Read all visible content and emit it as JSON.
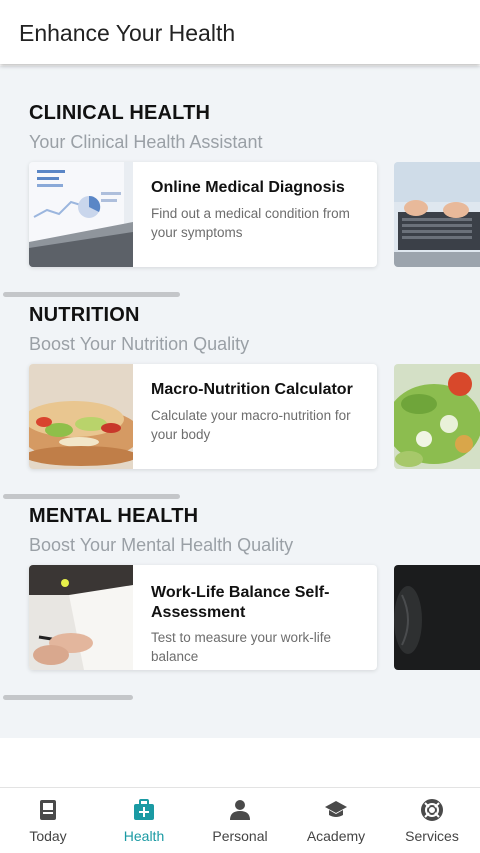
{
  "app_bar": {
    "title": "Enhance Your Health"
  },
  "sections": [
    {
      "title": "CLINICAL HEALTH",
      "subtitle": "Your Clinical Health Assistant",
      "card": {
        "title": "Online Medical Diagnosis",
        "description": "Find out a medical condition from your symptoms",
        "image": "laptop-chart-photo"
      },
      "peek_image": "hands-typing-laptop-photo"
    },
    {
      "title": "NUTRITION",
      "subtitle": "Boost Your Nutrition Quality",
      "card": {
        "title": "Macro-Nutrition Calculator",
        "description": "Calculate your macro-nutrition for your body",
        "image": "sandwich-photo"
      },
      "peek_image": "salad-photo"
    },
    {
      "title": "MENTAL HEALTH",
      "subtitle": "Boost Your Mental Health Quality",
      "card": {
        "title": "Work-Life Balance Self-Assessment",
        "description": "Test to measure your work-life balance",
        "image": "desk-notebook-photo"
      },
      "peek_image": "dark-portrait-photo"
    }
  ],
  "bottom_nav": {
    "active": "Health",
    "accent_color": "#1a9aa3",
    "items": [
      {
        "label": "Today",
        "icon": "book-icon"
      },
      {
        "label": "Health",
        "icon": "medical-kit-icon"
      },
      {
        "label": "Personal",
        "icon": "person-icon"
      },
      {
        "label": "Academy",
        "icon": "graduation-cap-icon"
      },
      {
        "label": "Services",
        "icon": "lifebuoy-icon"
      }
    ]
  }
}
